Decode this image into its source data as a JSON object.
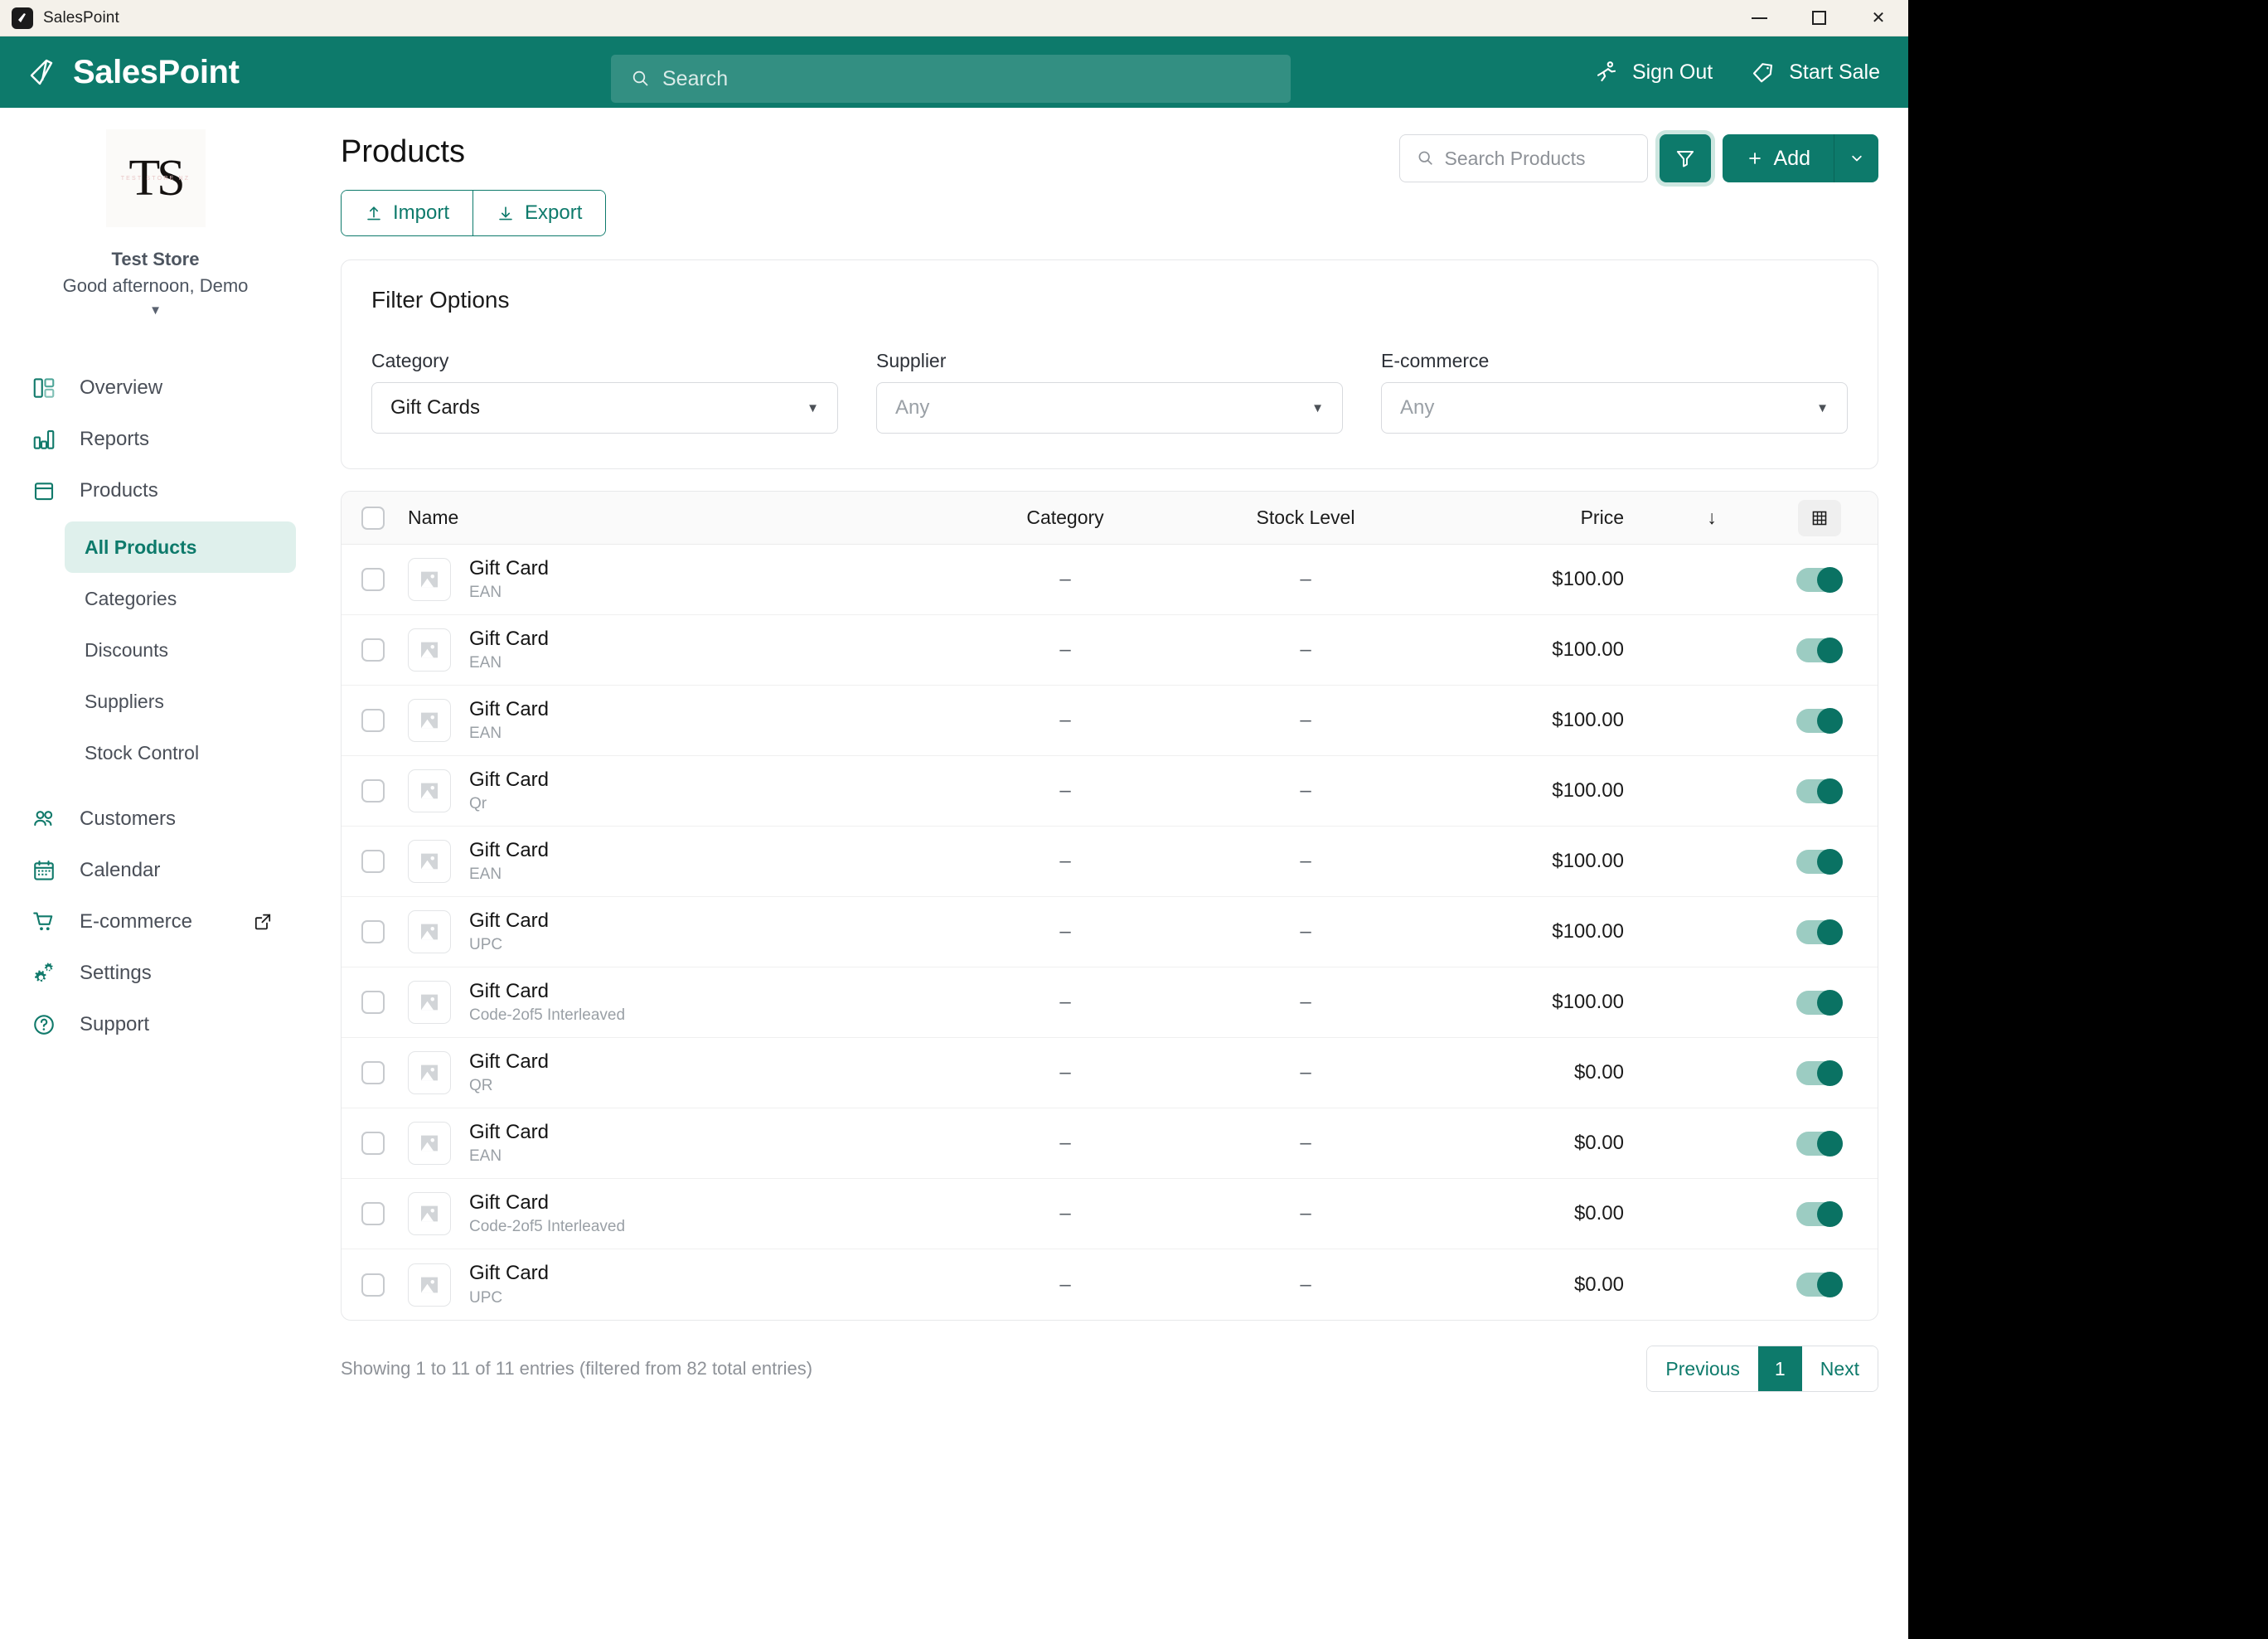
{
  "window": {
    "title": "SalesPoint",
    "controls": {
      "minimize": "minimize-button",
      "maximize": "maximize-button",
      "close": "close-button"
    }
  },
  "appbar": {
    "brand": "SalesPoint",
    "search_placeholder": "Search",
    "sign_out": "Sign Out",
    "start_sale": "Start Sale"
  },
  "sidebar": {
    "store": {
      "logo_initials": "TS",
      "logo_subtext": "TEST STORE NZ",
      "name": "Test Store",
      "greeting": "Good afternoon, Demo"
    },
    "items": [
      {
        "label": "Overview",
        "icon": "dashboard-icon"
      },
      {
        "label": "Reports",
        "icon": "bar-chart-icon"
      },
      {
        "label": "Products",
        "icon": "box-icon"
      },
      {
        "label": "Customers",
        "icon": "users-icon"
      },
      {
        "label": "Calendar",
        "icon": "calendar-icon"
      },
      {
        "label": "E-commerce",
        "icon": "cart-icon"
      },
      {
        "label": "Settings",
        "icon": "gears-icon"
      },
      {
        "label": "Support",
        "icon": "question-circle-icon"
      }
    ],
    "product_subitems": [
      {
        "label": "All Products",
        "active": true
      },
      {
        "label": "Categories",
        "active": false
      },
      {
        "label": "Discounts",
        "active": false
      },
      {
        "label": "Suppliers",
        "active": false
      },
      {
        "label": "Stock Control",
        "active": false
      }
    ]
  },
  "page": {
    "title": "Products",
    "import_label": "Import",
    "export_label": "Export",
    "search_placeholder": "Search Products",
    "add_label": "Add"
  },
  "filters": {
    "title": "Filter Options",
    "category": {
      "label": "Category",
      "value": "Gift Cards",
      "is_placeholder": false
    },
    "supplier": {
      "label": "Supplier",
      "value": "Any",
      "is_placeholder": true
    },
    "ecommerce": {
      "label": "E-commerce",
      "value": "Any",
      "is_placeholder": true
    }
  },
  "table": {
    "columns": {
      "name": "Name",
      "category": "Category",
      "stock": "Stock Level",
      "price": "Price"
    },
    "sort_indicator": "↓",
    "rows": [
      {
        "name": "Gift Card",
        "barcode": "EAN",
        "category": "–",
        "stock": "–",
        "price": "$100.00",
        "enabled": true
      },
      {
        "name": "Gift Card",
        "barcode": "EAN",
        "category": "–",
        "stock": "–",
        "price": "$100.00",
        "enabled": true
      },
      {
        "name": "Gift Card",
        "barcode": "EAN",
        "category": "–",
        "stock": "–",
        "price": "$100.00",
        "enabled": true
      },
      {
        "name": "Gift Card",
        "barcode": "Qr",
        "category": "–",
        "stock": "–",
        "price": "$100.00",
        "enabled": true
      },
      {
        "name": "Gift Card",
        "barcode": "EAN",
        "category": "–",
        "stock": "–",
        "price": "$100.00",
        "enabled": true
      },
      {
        "name": "Gift Card",
        "barcode": "UPC",
        "category": "–",
        "stock": "–",
        "price": "$100.00",
        "enabled": true
      },
      {
        "name": "Gift Card",
        "barcode": "Code-2of5 Interleaved",
        "category": "–",
        "stock": "–",
        "price": "$100.00",
        "enabled": true
      },
      {
        "name": "Gift Card",
        "barcode": "QR",
        "category": "–",
        "stock": "–",
        "price": "$0.00",
        "enabled": true
      },
      {
        "name": "Gift Card",
        "barcode": "EAN",
        "category": "–",
        "stock": "–",
        "price": "$0.00",
        "enabled": true
      },
      {
        "name": "Gift Card",
        "barcode": "Code-2of5 Interleaved",
        "category": "–",
        "stock": "–",
        "price": "$0.00",
        "enabled": true
      },
      {
        "name": "Gift Card",
        "barcode": "UPC",
        "category": "–",
        "stock": "–",
        "price": "$0.00",
        "enabled": true
      }
    ]
  },
  "footer": {
    "summary": "Showing 1 to 11 of 11 entries (filtered from 82 total entries)",
    "previous": "Previous",
    "page": "1",
    "next": "Next"
  },
  "colors": {
    "brand": "#0d7a6b",
    "brand_dark": "#0a6458",
    "active_bg": "#dff0ec",
    "toggle_track": "#9cccc2"
  }
}
